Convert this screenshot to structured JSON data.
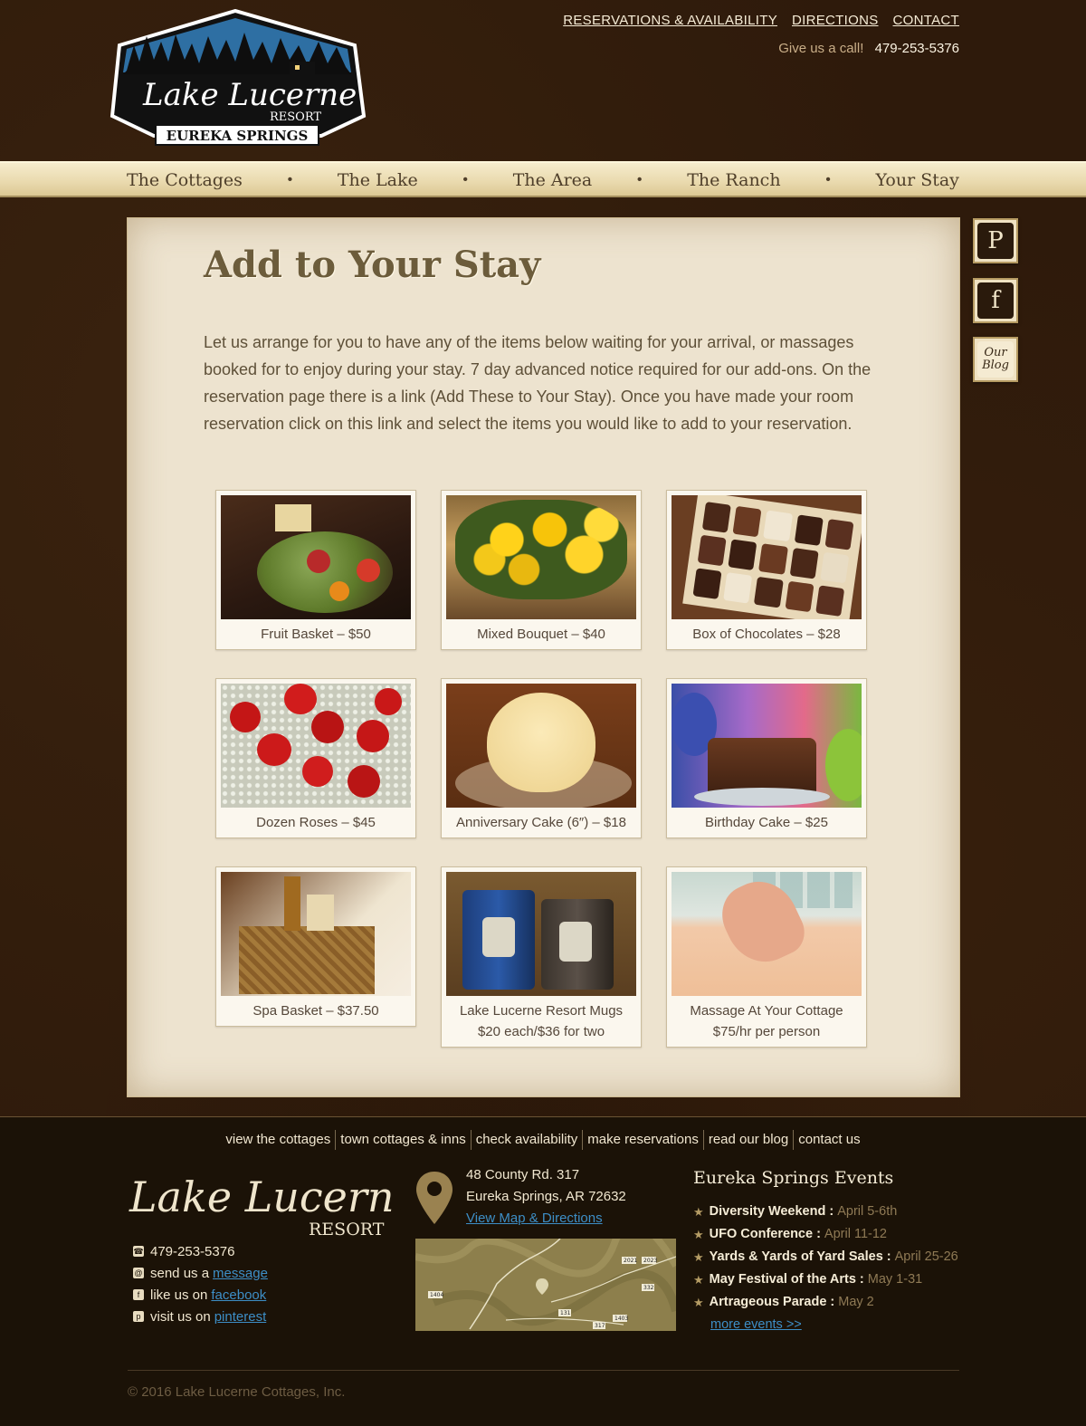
{
  "header": {
    "logo": {
      "line1": "Lake Lucerne",
      "line2": "RESORT",
      "line3": "EUREKA SPRINGS"
    },
    "top_links": [
      "RESERVATIONS & AVAILABILITY",
      "DIRECTIONS",
      "CONTACT"
    ],
    "call_label": "Give us a call!",
    "phone": "479-253-5376"
  },
  "nav": {
    "items": [
      "The Cottages",
      "The Lake",
      "The Area",
      "The Ranch",
      "Your Stay"
    ],
    "separator": "•"
  },
  "social": {
    "pinterest_icon": "pinterest-icon",
    "facebook_icon": "facebook-icon",
    "blog_label": "Our Blog"
  },
  "main": {
    "title": "Add to Your Stay",
    "intro": "Let us arrange for you to have any of the items below waiting for your arrival, or massages booked for to enjoy during your stay. 7 day advanced notice required for our add-ons. On the reservation page there is a link (Add These to Your Stay). Once you have made your room reservation click on this link and select the items you would like to add to your reservation.",
    "items": [
      {
        "caption": "Fruit Basket – $50",
        "caption2": ""
      },
      {
        "caption": "Mixed Bouquet – $40",
        "caption2": ""
      },
      {
        "caption": "Box of Chocolates – $28",
        "caption2": ""
      },
      {
        "caption": "Dozen Roses – $45",
        "caption2": ""
      },
      {
        "caption": "Anniversary Cake (6″) – $18",
        "caption2": ""
      },
      {
        "caption": "Birthday Cake – $25",
        "caption2": ""
      },
      {
        "caption": "Spa Basket – $37.50",
        "caption2": ""
      },
      {
        "caption": "Lake Lucerne Resort Mugs",
        "caption2": "$20 each/$36 for two"
      },
      {
        "caption": "Massage At Your Cottage",
        "caption2": "$75/hr per person"
      }
    ]
  },
  "footer": {
    "links": [
      "view the cottages",
      "town cottages & inns",
      "check availability",
      "make reservations",
      "read our blog",
      "contact us"
    ],
    "logo": {
      "line1": "Lake Lucerne",
      "line2": "RESORT"
    },
    "contact": {
      "phone": "479-253-5376",
      "message_prefix": "send us a",
      "message_link": "message",
      "facebook_prefix": "like us on",
      "facebook_link": "facebook",
      "pinterest_prefix": "visit us on",
      "pinterest_link": "pinterest"
    },
    "address": {
      "line1": "48 County Rd. 317",
      "line2": "Eureka Springs, AR  72632",
      "link": "View Map & Directions"
    },
    "map_labels": [
      "2021",
      "2023",
      "1404",
      "332",
      "131",
      "1403",
      "317"
    ],
    "events": {
      "title": "Eureka Springs Events",
      "list": [
        {
          "name": "Diversity Weekend :",
          "date": "April 5-6th"
        },
        {
          "name": "UFO Conference :",
          "date": "April 11-12"
        },
        {
          "name": "Yards & Yards of Yard Sales :",
          "date": "April 25-26"
        },
        {
          "name": "May Festival of the Arts :",
          "date": "May 1-31"
        },
        {
          "name": "Artrageous Parade :",
          "date": "May 2"
        }
      ],
      "more": "more events >>"
    },
    "copyright": "© 2016 Lake Lucerne Cottages, Inc."
  }
}
